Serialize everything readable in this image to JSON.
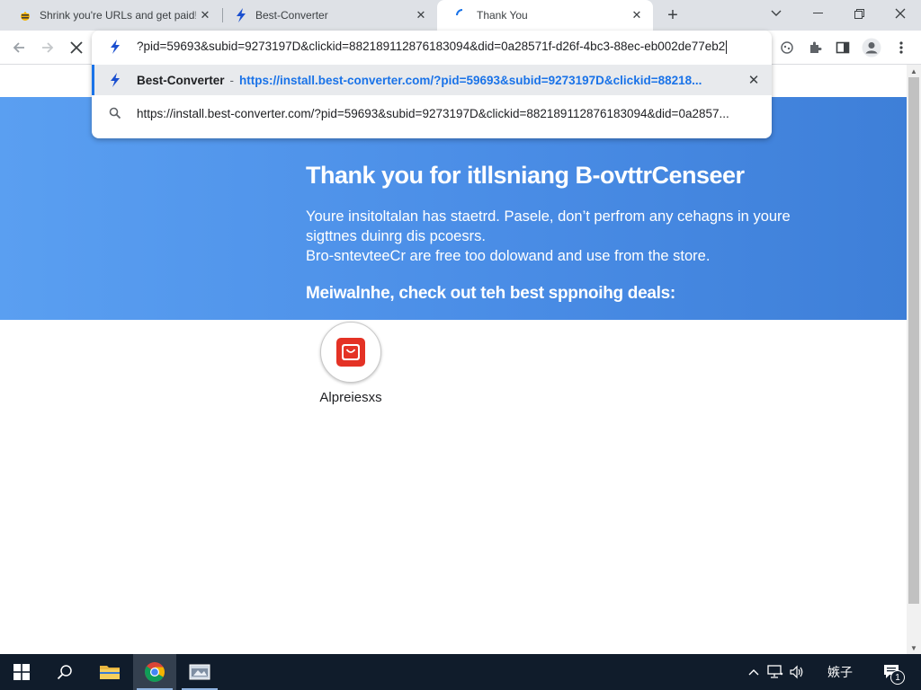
{
  "tabs": [
    {
      "title": "Shrink you're URLs and get paid!",
      "icon": "bee-icon",
      "active": false
    },
    {
      "title": "Best-Converter",
      "icon": "best-converter-icon",
      "active": false
    },
    {
      "title": "Thank You",
      "icon": "loading-spinner-icon",
      "active": true
    }
  ],
  "omnibox": {
    "typed_text": "?pid=59693&subid=9273197D&clickid=882189112876183094&did=0a28571f-d26f-4bc3-88ec-eb002de77eb2",
    "suggestion_1": {
      "title": "Best-Converter",
      "separator": "-",
      "url": "https://install.best-converter.com/?pid=59693&subid=9273197D&clickid=88218..."
    },
    "suggestion_2": {
      "url": "https://install.best-converter.com/?pid=59693&subid=9273197D&clickid=882189112876183094&did=0a2857..."
    }
  },
  "page": {
    "title": "Thank you for itllsniang B-ovttrCenseer",
    "paragraph_line1": "Youre insitoltalan has staetrd. Pasele, don’t perfrom any cehagns in youre sigttnes duinrg dis pcoesrs.",
    "paragraph_line2": "Bro-sntevteeCr are free too dolowand and use from the store.",
    "subtitle": "Meiwalnhe, check out teh best sppnoihg deals:",
    "store_label": "Alpreiesxs"
  },
  "taskbar": {
    "ime": "嫉子",
    "notification_count": "1"
  },
  "colors": {
    "hero_blue": "#4a8de6",
    "accent": "#1a73e8",
    "taskbar": "#101c2b"
  }
}
